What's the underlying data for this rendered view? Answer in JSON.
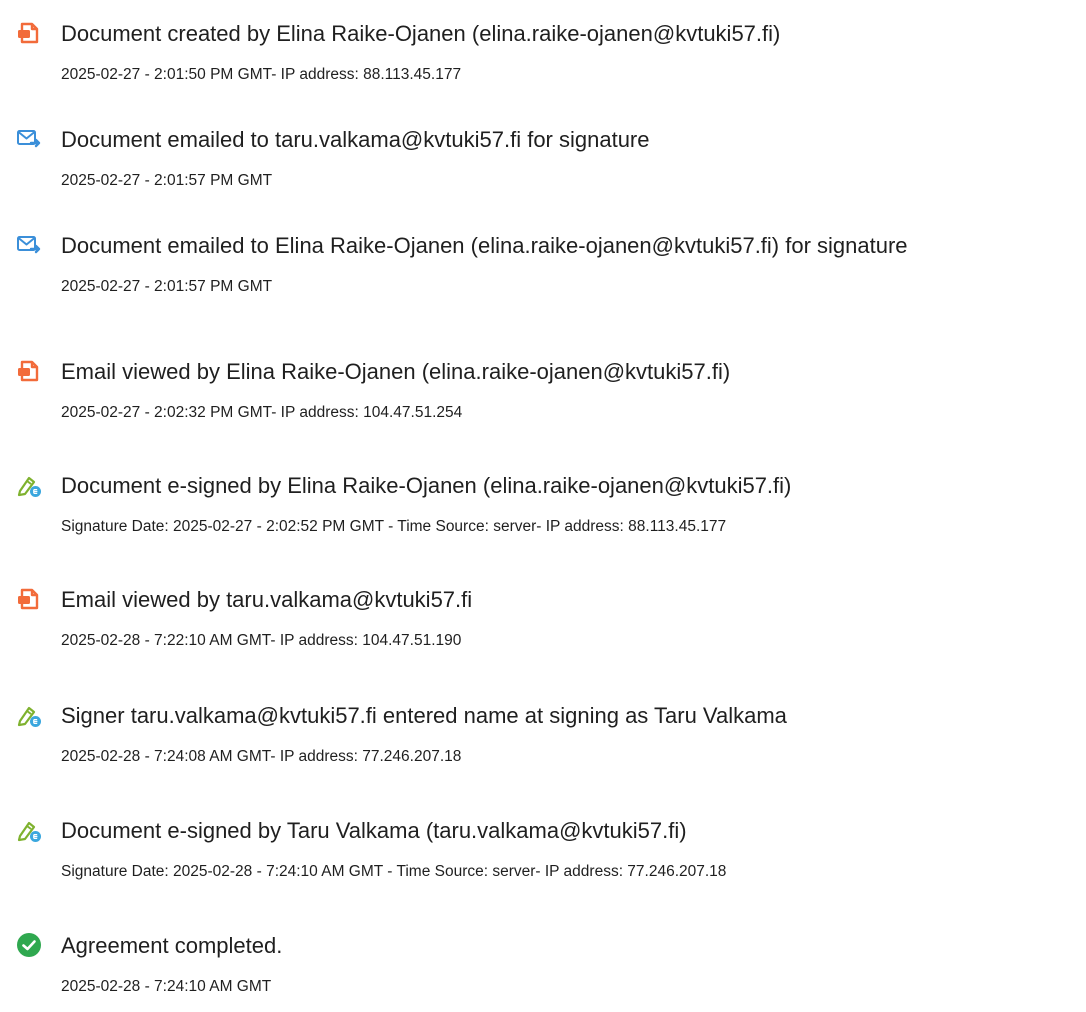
{
  "events": [
    {
      "icon": "document-created-icon",
      "title": "Document created by Elina Raike-Ojanen (elina.raike-ojanen@kvtuki57.fi)",
      "meta": "2025-02-27 - 2:01:50 PM GMT- IP address: 88.113.45.177"
    },
    {
      "icon": "email-sent-icon",
      "title": "Document emailed to taru.valkama@kvtuki57.fi for signature",
      "meta": "2025-02-27 - 2:01:57 PM GMT"
    },
    {
      "icon": "email-sent-icon",
      "title": "Document emailed to Elina Raike-Ojanen (elina.raike-ojanen@kvtuki57.fi) for signature",
      "meta": "2025-02-27 - 2:01:57 PM GMT"
    },
    {
      "icon": "document-created-icon",
      "title": "Email viewed by Elina Raike-Ojanen (elina.raike-ojanen@kvtuki57.fi)",
      "meta": "2025-02-27 - 2:02:32 PM GMT- IP address: 104.47.51.254"
    },
    {
      "icon": "e-sign-pen-icon",
      "title": "Document e-signed by Elina Raike-Ojanen (elina.raike-ojanen@kvtuki57.fi)",
      "meta": "Signature Date: 2025-02-27 - 2:02:52 PM GMT - Time Source: server- IP address: 88.113.45.177"
    },
    {
      "icon": "document-created-icon",
      "title": "Email viewed by taru.valkama@kvtuki57.fi",
      "meta": "2025-02-28 - 7:22:10 AM GMT- IP address: 104.47.51.190"
    },
    {
      "icon": "e-sign-pen-icon",
      "title": "Signer taru.valkama@kvtuki57.fi entered name at signing as Taru Valkama",
      "meta": "2025-02-28 - 7:24:08 AM GMT- IP address: 77.246.207.18"
    },
    {
      "icon": "e-sign-pen-icon",
      "title": "Document e-signed by Taru Valkama (taru.valkama@kvtuki57.fi)",
      "meta": "Signature Date: 2025-02-28 - 7:24:10 AM GMT - Time Source: server- IP address: 77.246.207.18"
    },
    {
      "icon": "checkmark-circle-icon",
      "title": "Agreement completed.",
      "meta": "2025-02-28 - 7:24:10 AM GMT"
    }
  ],
  "colors": {
    "document_icon": "#f26b3a",
    "email_icon": "#3b8fd9",
    "sign_icon_pen": "#7fb22f",
    "sign_icon_badge": "#3aa7de",
    "check_icon": "#2fa84f"
  }
}
